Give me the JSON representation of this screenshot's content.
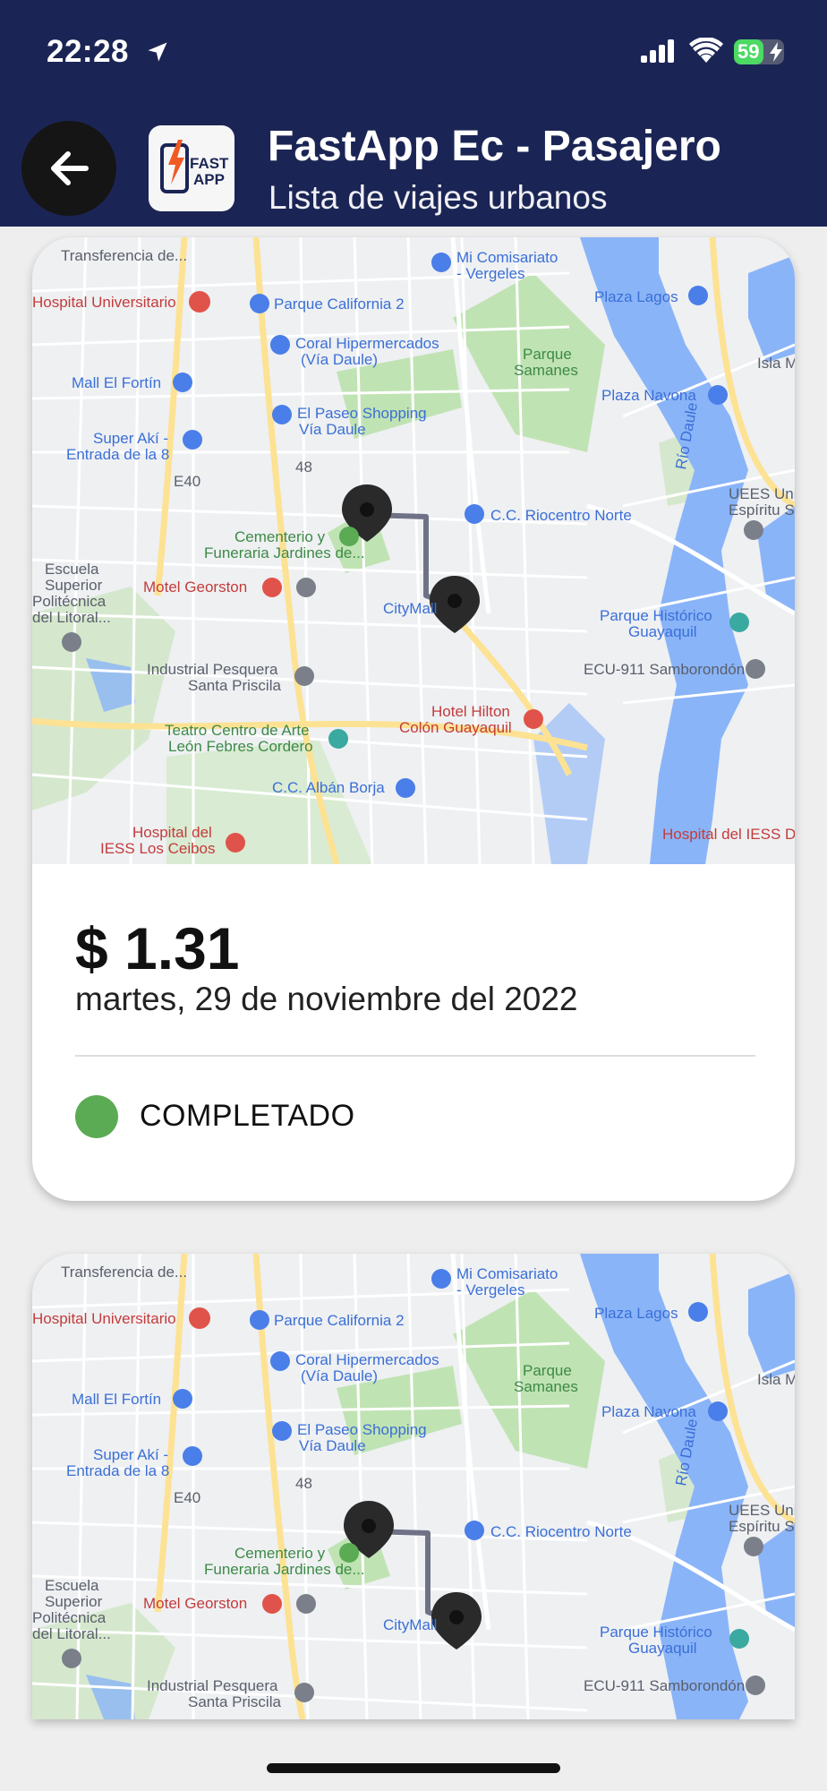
{
  "status_bar": {
    "time": "22:28",
    "battery": "59",
    "battery_level": 0.59,
    "icons": [
      "location-arrow-icon",
      "cellular-signal-icon",
      "wifi-icon",
      "battery-charging-icon"
    ]
  },
  "header": {
    "title": "FastApp Ec - Pasajero",
    "subtitle": "Lista de viajes urbanos",
    "back_icon": "arrow-left-icon",
    "logo_text_1": "FAST",
    "logo_text_2": "APP",
    "background_color": "#1b2555"
  },
  "map_labels": {
    "transferencia": "Transferencia de...",
    "mi_comisariato": "Mi Comisariato",
    "vergeles": "- Vergeles",
    "hospital_universitario": "Hospital Universitario",
    "parque_california": "Parque California 2",
    "plaza_lagos": "Plaza Lagos",
    "coral_1": "Coral Hipermercados",
    "coral_2": "(Vía Daule)",
    "parque_samanes_1": "Parque",
    "parque_samanes_2": "Samanes",
    "isla": "Isla M",
    "mall_fortin": "Mall El Fortín",
    "paseo_1": "El Paseo Shopping",
    "paseo_2": "Vía Daule",
    "plaza_navona": "Plaza Navona",
    "super_aki_1": "Super Akí -",
    "super_aki_2": "Entrada de la 8",
    "e40": "E40",
    "r48": "48",
    "rio_daule": "Río Daule",
    "uees_1": "UEES Uni",
    "uees_2": "Espíritu S",
    "riocentro": "C.C. Riocentro Norte",
    "cementerio_1": "Cementerio y",
    "cementerio_2": "Funeraria Jardines de...",
    "escuela_1": "Escuela",
    "escuela_2": "Superior",
    "escuela_3": "Politécnica",
    "escuela_4": "del Litoral...",
    "motel": "Motel Georston",
    "citymall": "CityMall",
    "parque_historico_1": "Parque Histórico",
    "parque_historico_2": "Guayaquil",
    "pesquera_1": "Industrial Pesquera",
    "pesquera_2": "Santa Priscila",
    "ecu911": "ECU-911 Samborondón",
    "hilton_1": "Hotel Hilton",
    "hilton_2": "Colón Guayaquil",
    "teatro_1": "Teatro Centro de Arte",
    "teatro_2": "León Febres Cordero",
    "alban_borja": "C.C. Albán Borja",
    "hospital_ceibos_1": "Hospital del",
    "hospital_ceibos_2": "IESS Los Ceibos",
    "hospital_iess": "Hospital del IESS D"
  },
  "trips": [
    {
      "price": "$ 1.31",
      "date": "martes, 29 de noviembre del 2022",
      "status": "COMPLETADO",
      "status_color": "#5aab53"
    }
  ],
  "colors": {
    "water": "#8ab4f8",
    "park": "#c0e3b3",
    "highway": "#fde293",
    "route": "#6f7287",
    "land": "#f1f3f4"
  }
}
